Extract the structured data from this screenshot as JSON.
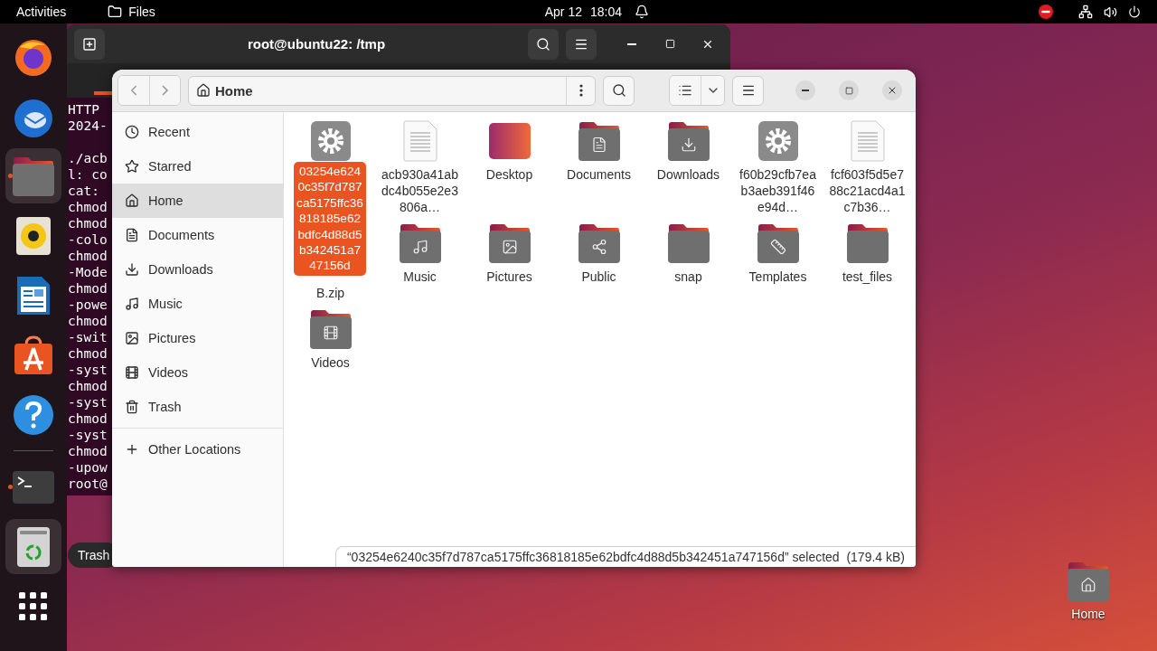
{
  "top_bar": {
    "activities": "Activities",
    "app_name": "Files",
    "date": "Apr 12",
    "time": "18:04"
  },
  "dock": {
    "items": [
      {
        "kind": "browser",
        "running": false,
        "highlighted": false
      },
      {
        "kind": "mail",
        "running": false,
        "highlighted": false
      },
      {
        "kind": "files",
        "running": true,
        "highlighted": true
      },
      {
        "kind": "music",
        "running": false,
        "highlighted": false
      },
      {
        "kind": "writer",
        "running": false,
        "highlighted": false
      },
      {
        "kind": "store",
        "running": false,
        "highlighted": false
      },
      {
        "kind": "help",
        "running": false,
        "highlighted": false
      },
      {
        "kind": "terminal",
        "running": true,
        "highlighted": false
      },
      {
        "kind": "trash",
        "running": false,
        "highlighted": true
      },
      {
        "kind": "apps",
        "running": false,
        "highlighted": false
      }
    ],
    "tooltip": "Trash"
  },
  "terminal": {
    "title": "root@ubuntu22: /tmp",
    "blocks": [
      [
        "HTTP",
        "2024-"
      ],
      [
        "./acb",
        "l: co",
        "cat: ",
        "chmod",
        "chmod",
        "-colo",
        "chmod",
        "-Mode",
        "chmod",
        "-powe",
        "chmod",
        "-swit",
        "chmod",
        "-syst",
        "chmod",
        "-syst",
        "chmod",
        "-syst",
        "chmod",
        "-upow",
        "root@"
      ]
    ]
  },
  "files": {
    "location": "Home",
    "sidebar": {
      "items": [
        {
          "label": "Recent",
          "selected": false
        },
        {
          "label": "Starred",
          "selected": false
        },
        {
          "label": "Home",
          "selected": true
        },
        {
          "label": "Documents",
          "selected": false
        },
        {
          "label": "Downloads",
          "selected": false
        },
        {
          "label": "Music",
          "selected": false
        },
        {
          "label": "Pictures",
          "selected": false
        },
        {
          "label": "Videos",
          "selected": false
        },
        {
          "label": "Trash",
          "selected": false
        }
      ],
      "other_locations": "Other Locations"
    },
    "items": [
      {
        "name": "03254e6240c35f7d787ca5175ffc36818185e62bdfc4d88d5b342451a747156d",
        "kind": "executable",
        "selected": true
      },
      {
        "name": "acb930a41abdc4b055e2e3806a…",
        "kind": "text",
        "selected": false
      },
      {
        "name": "Desktop",
        "kind": "desktop",
        "selected": false
      },
      {
        "name": "Documents",
        "kind": "documents-folder",
        "selected": false
      },
      {
        "name": "Downloads",
        "kind": "downloads-folder",
        "selected": false
      },
      {
        "name": "f60b29cfb7eab3aeb391f46e94d…",
        "kind": "executable",
        "selected": false
      },
      {
        "name": "fcf603f5d5e788c21acd4a1c7b36…",
        "kind": "text",
        "selected": false
      },
      {
        "name": "B.zip",
        "kind": "covered",
        "selected": false
      },
      {
        "name": "Music",
        "kind": "music-folder",
        "selected": false
      },
      {
        "name": "Pictures",
        "kind": "pictures-folder",
        "selected": false
      },
      {
        "name": "Public",
        "kind": "public-folder",
        "selected": false
      },
      {
        "name": "snap",
        "kind": "folder",
        "selected": false
      },
      {
        "name": "Templates",
        "kind": "templates-folder",
        "selected": false
      },
      {
        "name": "test_files",
        "kind": "folder",
        "selected": false
      },
      {
        "name": "Videos",
        "kind": "videos-folder",
        "selected": false
      }
    ],
    "status": "“03254e6240c35f7d787ca5175ffc36818185e62bdfc4d88d5b342451a747156d” selected  (179.4 kB)"
  },
  "desktop_icons": [
    {
      "label": "Home",
      "kind": "home-folder"
    }
  ]
}
